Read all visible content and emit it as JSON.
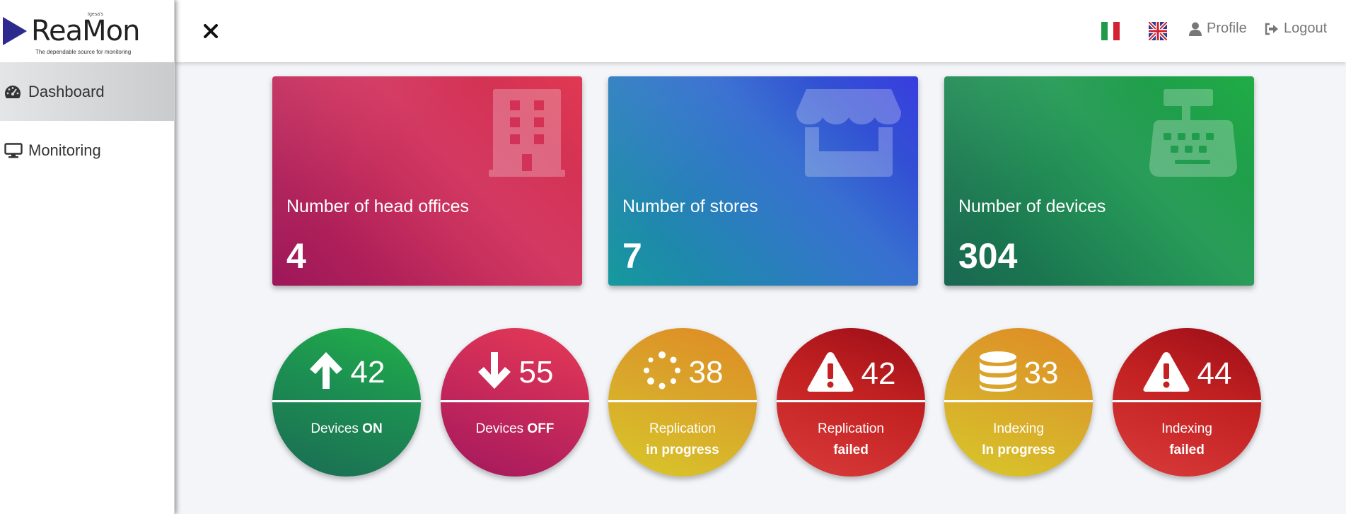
{
  "logo": {
    "name": "ReaMon",
    "superscript": "Igesa's",
    "tagline": "The dependable source for monitoring"
  },
  "sidebar": {
    "items": [
      {
        "label": "Dashboard",
        "icon": "tachometer-icon",
        "active": true
      },
      {
        "label": "Monitoring",
        "icon": "monitor-icon",
        "active": false
      }
    ]
  },
  "topbar": {
    "close_icon": "close-icon",
    "languages": [
      "it",
      "uk"
    ],
    "profile_label": "Profile",
    "logout_label": "Logout"
  },
  "cards": [
    {
      "label": "Number of head offices",
      "value": "4",
      "icon": "building-icon",
      "color": "#d12c58"
    },
    {
      "label": "Number of stores",
      "value": "7",
      "icon": "store-icon",
      "color": "#2a6fd0"
    },
    {
      "label": "Number of devices",
      "value": "304",
      "icon": "cash-register-icon",
      "color": "#1e9a4e"
    }
  ],
  "circles": [
    {
      "value": "42",
      "line1": "Devices",
      "bold1": "ON",
      "line2": "",
      "icon": "arrow-up-icon"
    },
    {
      "value": "55",
      "line1": "Devices",
      "bold1": "OFF",
      "line2": "",
      "icon": "arrow-down-icon"
    },
    {
      "value": "38",
      "line1": "Replication",
      "bold1": "",
      "line2": "in progress",
      "icon": "spinner-icon"
    },
    {
      "value": "42",
      "line1": "Replication",
      "bold1": "",
      "line2": "failed",
      "icon": "warning-icon"
    },
    {
      "value": "33",
      "line1": "Indexing",
      "bold1": "",
      "line2": "In progress",
      "icon": "database-icon"
    },
    {
      "value": "44",
      "line1": "Indexing",
      "bold1": "",
      "line2": "failed",
      "icon": "warning-icon"
    }
  ]
}
